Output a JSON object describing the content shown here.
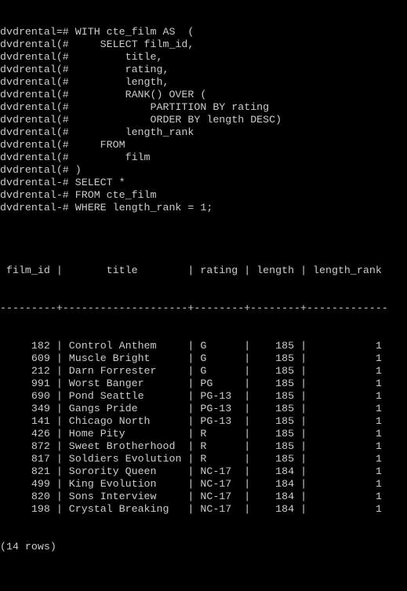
{
  "terminal": {
    "query_lines": [
      {
        "prompt": "dvdrental=# ",
        "text": "WITH cte_film AS  ("
      },
      {
        "prompt": "dvdrental(# ",
        "text": "    SELECT film_id,"
      },
      {
        "prompt": "dvdrental(# ",
        "text": "        title,"
      },
      {
        "prompt": "dvdrental(# ",
        "text": "        rating,"
      },
      {
        "prompt": "dvdrental(# ",
        "text": "        length,"
      },
      {
        "prompt": "dvdrental(# ",
        "text": "        RANK() OVER ("
      },
      {
        "prompt": "dvdrental(# ",
        "text": "            PARTITION BY rating"
      },
      {
        "prompt": "dvdrental(# ",
        "text": "            ORDER BY length DESC)"
      },
      {
        "prompt": "dvdrental(# ",
        "text": "        length_rank"
      },
      {
        "prompt": "dvdrental(# ",
        "text": "    FROM"
      },
      {
        "prompt": "dvdrental(# ",
        "text": "        film"
      },
      {
        "prompt": "dvdrental(# ",
        "text": ")"
      },
      {
        "prompt": "dvdrental-# ",
        "text": "SELECT *"
      },
      {
        "prompt": "dvdrental-# ",
        "text": "FROM cte_film"
      },
      {
        "prompt": "dvdrental-# ",
        "text": "WHERE length_rank = 1;"
      }
    ],
    "result": {
      "columns": [
        "film_id",
        "title",
        "rating",
        "length",
        "length_rank"
      ],
      "rows": [
        {
          "film_id": "182",
          "title": "Control Anthem",
          "rating": "G",
          "length": "185",
          "length_rank": "1"
        },
        {
          "film_id": "609",
          "title": "Muscle Bright",
          "rating": "G",
          "length": "185",
          "length_rank": "1"
        },
        {
          "film_id": "212",
          "title": "Darn Forrester",
          "rating": "G",
          "length": "185",
          "length_rank": "1"
        },
        {
          "film_id": "991",
          "title": "Worst Banger",
          "rating": "PG",
          "length": "185",
          "length_rank": "1"
        },
        {
          "film_id": "690",
          "title": "Pond Seattle",
          "rating": "PG-13",
          "length": "185",
          "length_rank": "1"
        },
        {
          "film_id": "349",
          "title": "Gangs Pride",
          "rating": "PG-13",
          "length": "185",
          "length_rank": "1"
        },
        {
          "film_id": "141",
          "title": "Chicago North",
          "rating": "PG-13",
          "length": "185",
          "length_rank": "1"
        },
        {
          "film_id": "426",
          "title": "Home Pity",
          "rating": "R",
          "length": "185",
          "length_rank": "1"
        },
        {
          "film_id": "872",
          "title": "Sweet Brotherhood",
          "rating": "R",
          "length": "185",
          "length_rank": "1"
        },
        {
          "film_id": "817",
          "title": "Soldiers Evolution",
          "rating": "R",
          "length": "185",
          "length_rank": "1"
        },
        {
          "film_id": "821",
          "title": "Sorority Queen",
          "rating": "NC-17",
          "length": "184",
          "length_rank": "1"
        },
        {
          "film_id": "499",
          "title": "King Evolution",
          "rating": "NC-17",
          "length": "184",
          "length_rank": "1"
        },
        {
          "film_id": "820",
          "title": "Sons Interview",
          "rating": "NC-17",
          "length": "184",
          "length_rank": "1"
        },
        {
          "film_id": "198",
          "title": "Crystal Breaking",
          "rating": "NC-17",
          "length": "184",
          "length_rank": "1"
        }
      ],
      "footer": "(14 rows)"
    },
    "colors": {
      "background": "#000000",
      "foreground": "#cccccc"
    }
  }
}
